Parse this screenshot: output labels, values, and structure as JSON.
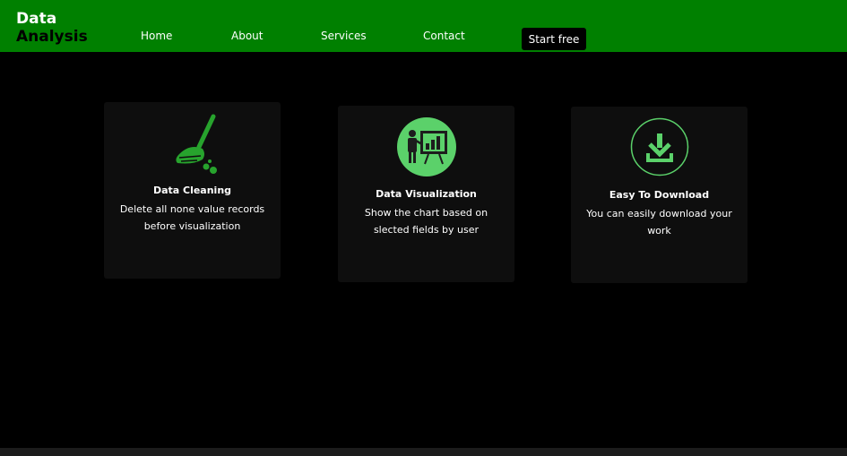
{
  "brand": {
    "line1": "Data",
    "line2": "Analysis"
  },
  "nav": {
    "items": [
      {
        "label": "Home"
      },
      {
        "label": "About"
      },
      {
        "label": "Services"
      },
      {
        "label": "Contact"
      }
    ],
    "cta_label": "Start free"
  },
  "features": [
    {
      "title": "Data Cleaning",
      "description": "Delete all none value records before visualization",
      "icon": "broom-icon"
    },
    {
      "title": "Data Visualization",
      "description": "Show the chart based on slected fields by user",
      "icon": "presentation-chart-icon"
    },
    {
      "title": "Easy To Download",
      "description": "You can easily download your work",
      "icon": "download-icon"
    }
  ],
  "colors": {
    "navbar": "#008000",
    "accent_green": "#5bd16a",
    "icon_green": "#27a32d",
    "card_bg": "#0e0e0e",
    "background": "#000000"
  }
}
